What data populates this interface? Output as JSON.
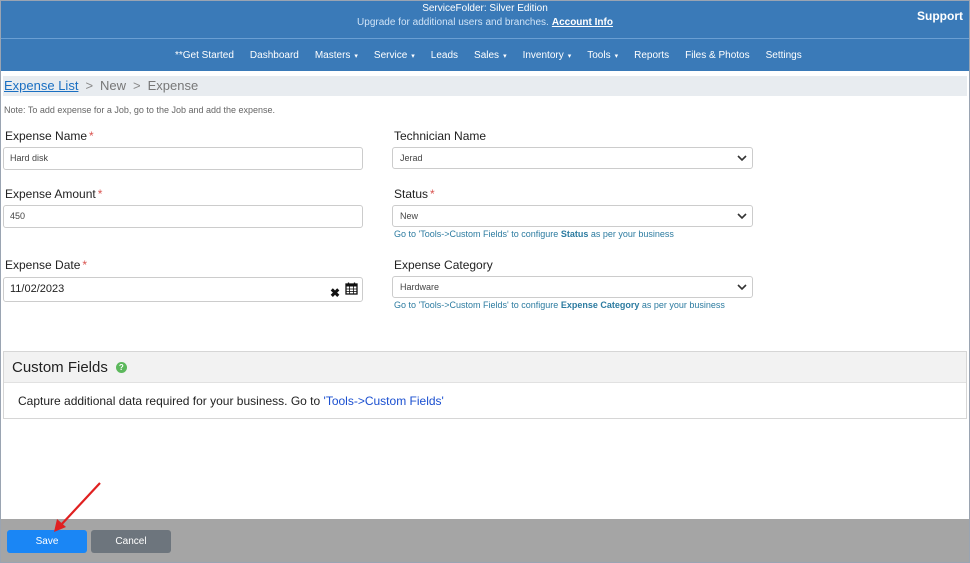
{
  "header": {
    "edition": "ServiceFolder: Silver Edition",
    "upgrade_text": "Upgrade for additional users and branches.",
    "account_link": "Account Info",
    "support": "Support"
  },
  "nav": {
    "items": [
      {
        "label": "**Get Started",
        "dropdown": false
      },
      {
        "label": "Dashboard",
        "dropdown": false
      },
      {
        "label": "Masters",
        "dropdown": true
      },
      {
        "label": "Service",
        "dropdown": true
      },
      {
        "label": "Leads",
        "dropdown": false
      },
      {
        "label": "Sales",
        "dropdown": true
      },
      {
        "label": "Inventory",
        "dropdown": true
      },
      {
        "label": "Tools",
        "dropdown": true
      },
      {
        "label": "Reports",
        "dropdown": false
      },
      {
        "label": "Files & Photos",
        "dropdown": false
      },
      {
        "label": "Settings",
        "dropdown": false
      }
    ]
  },
  "breadcrumb": {
    "link": "Expense List",
    "sep": ">",
    "items": [
      "New",
      "Expense"
    ]
  },
  "note": "Note: To add expense for a Job, go to the Job and add the expense.",
  "form": {
    "required_mark": "*",
    "expense_name": {
      "label": "Expense Name",
      "value": "Hard disk"
    },
    "expense_amount": {
      "label": "Expense Amount",
      "value": "450"
    },
    "expense_date": {
      "label": "Expense Date",
      "value": "11/02/2023"
    },
    "technician": {
      "label": "Technician Name",
      "value": "Jerad"
    },
    "status": {
      "label": "Status",
      "value": "New",
      "hint_prefix": "Go to",
      "hint_link": "'Tools->Custom Fields'",
      "hint_mid": "to configure",
      "hint_bold": "Status",
      "hint_suffix": "as per your business"
    },
    "category": {
      "label": "Expense Category",
      "value": "Hardware",
      "hint_prefix": "Go to",
      "hint_link": "'Tools->Custom Fields'",
      "hint_mid": "to configure",
      "hint_bold": "Expense Category",
      "hint_suffix": "as per your business"
    }
  },
  "custom_fields": {
    "title": "Custom Fields",
    "help_icon": "?",
    "text": "Capture additional data required for your business. Go to",
    "link": "'Tools->Custom Fields'"
  },
  "footer": {
    "save": "Save",
    "cancel": "Cancel"
  },
  "colors": {
    "nav_bg": "#3a7ab8",
    "save_btn": "#1a86f5",
    "cancel_btn": "#6d757d",
    "footer_bg": "#a5a5a5",
    "annotation_arrow": "#e02020"
  },
  "annotation": {
    "icon": "red-arrow-icon",
    "points_to": "save-button"
  }
}
